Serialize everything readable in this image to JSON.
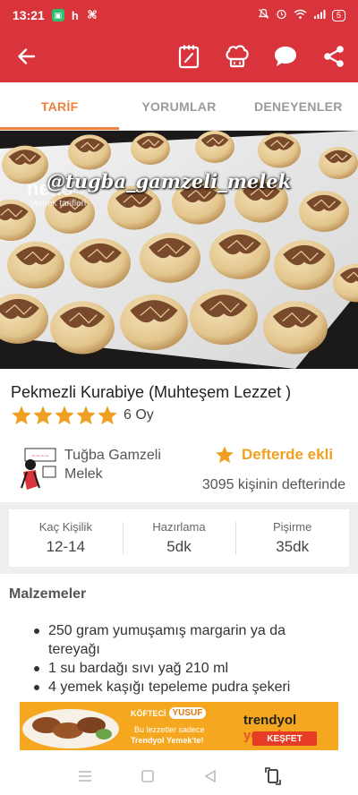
{
  "status_bar": {
    "time": "13:21",
    "app_badge": "▣",
    "h_letter": "h",
    "battery": "5"
  },
  "app_bar": {
    "icons": [
      "back-arrow-icon",
      "notebook-icon",
      "chef-hat-icon",
      "comment-icon",
      "share-icon"
    ]
  },
  "tabs": [
    {
      "label": "TARİF",
      "active": true
    },
    {
      "label": "YORUMLAR",
      "active": false
    },
    {
      "label": "DENEYENLER",
      "active": false
    }
  ],
  "hero": {
    "watermark": "@tugba_gamzeli_melek",
    "logo": "nefis",
    "logo_sub": "yemek tarifleri"
  },
  "recipe": {
    "title": "Pekmezli Kurabiye (Muhteşem Lezzet )",
    "rating": 5,
    "votes": "6 Oy"
  },
  "author": {
    "name": "Tuğba Gamzeli Melek",
    "notebook_label": "Defterde ekli",
    "notebook_count": "3095 kişinin defterinde"
  },
  "info": [
    {
      "label": "Kaç Kişilik",
      "value": "12-14"
    },
    {
      "label": "Hazırlama",
      "value": "5dk"
    },
    {
      "label": "Pişirme",
      "value": "35dk"
    }
  ],
  "ingredients": {
    "title": "Malzemeler",
    "items": [
      "250 gram yumuşamış margarin ya da tereyağı",
      "1 su bardağı sıvı yağ 210 ml",
      "4 yemek kaşığı tepeleme pudra şekeri"
    ]
  },
  "ad": {
    "brand_prefix": "KÖFTECİ",
    "brand_name": "YUSUF",
    "line1": "Bu lezzetler sadece",
    "line2": "Trendyol Yemek'te!",
    "platform": "trendyol",
    "platform_suffix": "yemek",
    "cta": "KEŞFET"
  },
  "colors": {
    "brand_red": "#d9343b",
    "accent_orange": "#f0803c",
    "star": "#f0a020"
  }
}
